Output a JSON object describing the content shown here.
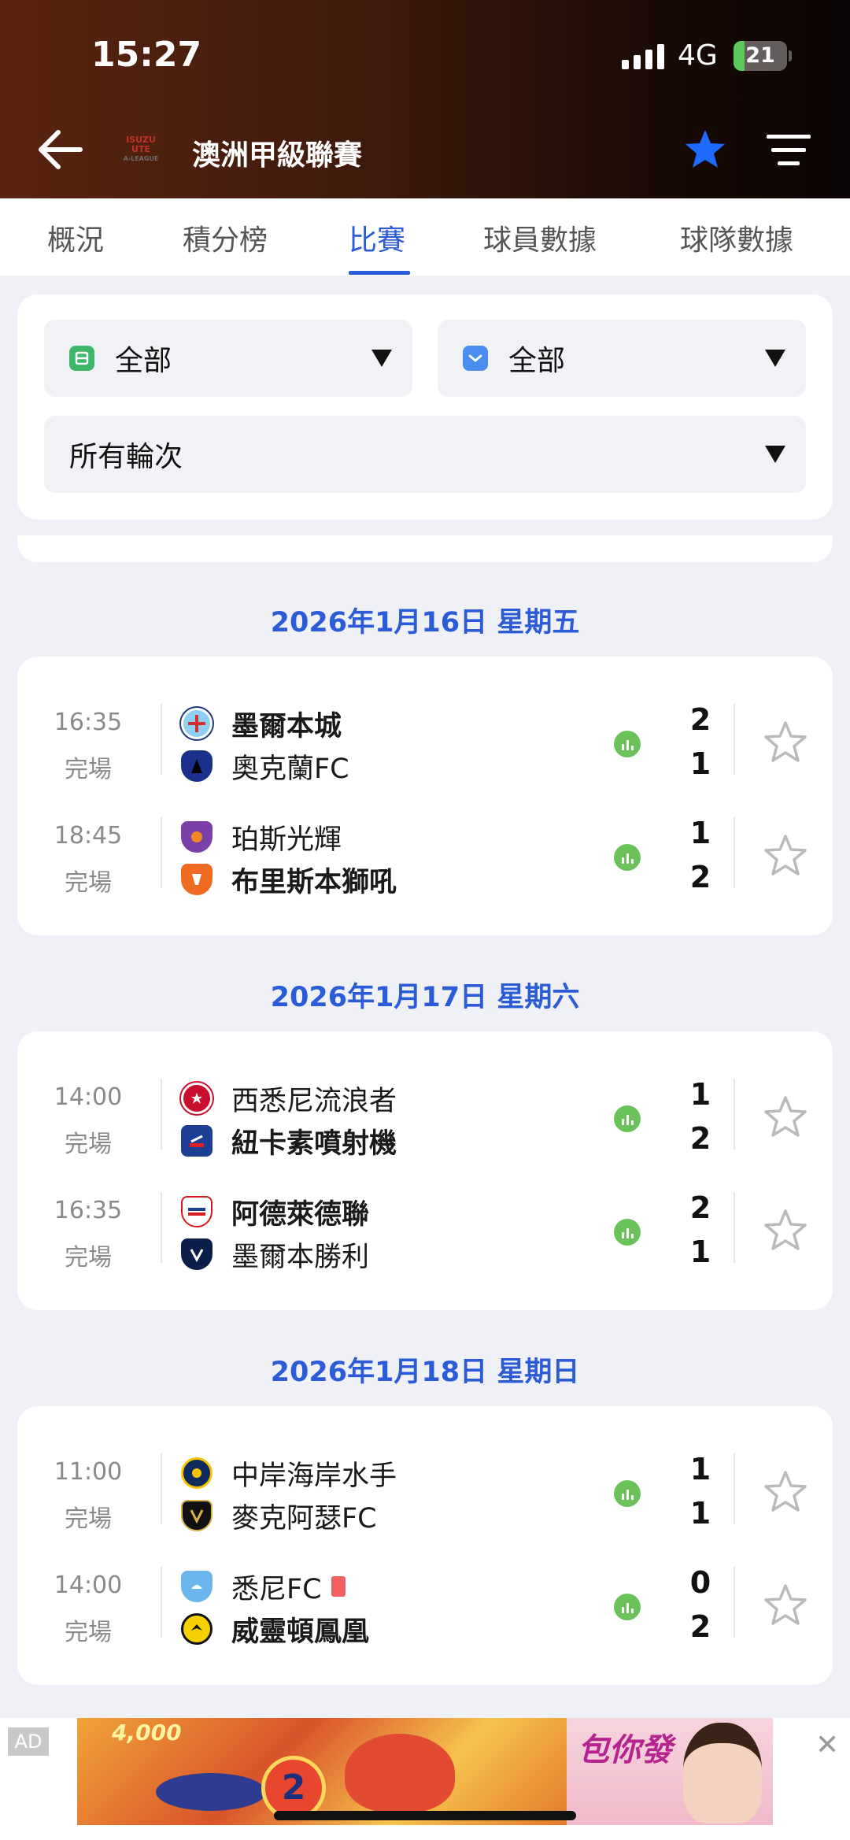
{
  "status_bar": {
    "time": "15:27",
    "network": "4G",
    "battery": "21",
    "battery_level": 0.21
  },
  "header": {
    "title": "澳洲甲級聯賽",
    "logo_text": [
      "ISUZU",
      "UTE",
      "A-LEAGUE"
    ],
    "favorite_color": "#1f6bff"
  },
  "tabs": [
    {
      "label": "概況"
    },
    {
      "label": "積分榜"
    },
    {
      "label": "比賽",
      "active": true
    },
    {
      "label": "球員數據"
    },
    {
      "label": "球隊數據"
    }
  ],
  "filters": {
    "team_filter": "全部",
    "date_filter": "全部",
    "round_filter": "所有輪次"
  },
  "days": [
    {
      "date": "2026年1月16日 星期五",
      "matches": [
        {
          "time": "16:35",
          "status": "完場",
          "home": {
            "name": "墨爾本城",
            "score": "2",
            "win": true,
            "logo": "melbourne-city-icon"
          },
          "away": {
            "name": "奧克蘭FC",
            "score": "1",
            "win": false,
            "logo": "auckland-fc-icon"
          }
        },
        {
          "time": "18:45",
          "status": "完場",
          "home": {
            "name": "珀斯光輝",
            "score": "1",
            "win": false,
            "logo": "perth-glory-icon"
          },
          "away": {
            "name": "布里斯本獅吼",
            "score": "2",
            "win": true,
            "logo": "brisbane-roar-icon"
          }
        }
      ]
    },
    {
      "date": "2026年1月17日 星期六",
      "matches": [
        {
          "time": "14:00",
          "status": "完場",
          "home": {
            "name": "西悉尼流浪者",
            "score": "1",
            "win": false,
            "logo": "western-sydney-icon"
          },
          "away": {
            "name": "紐卡素噴射機",
            "score": "2",
            "win": true,
            "logo": "newcastle-jets-icon"
          }
        },
        {
          "time": "16:35",
          "status": "完場",
          "home": {
            "name": "阿德萊德聯",
            "score": "2",
            "win": true,
            "logo": "adelaide-united-icon"
          },
          "away": {
            "name": "墨爾本勝利",
            "score": "1",
            "win": false,
            "logo": "melbourne-victory-icon"
          }
        }
      ]
    },
    {
      "date": "2026年1月18日 星期日",
      "matches": [
        {
          "time": "11:00",
          "status": "完場",
          "home": {
            "name": "中岸海岸水手",
            "score": "1",
            "win": false,
            "logo": "central-coast-icon"
          },
          "away": {
            "name": "麥克阿瑟FC",
            "score": "1",
            "win": false,
            "logo": "macarthur-fc-icon"
          }
        },
        {
          "time": "14:00",
          "status": "完場",
          "home": {
            "name": "悉尼FC",
            "score": "0",
            "win": false,
            "logo": "sydney-fc-icon",
            "red_card": true
          },
          "away": {
            "name": "威靈頓鳳凰",
            "score": "2",
            "win": true,
            "logo": "wellington-phoenix-icon"
          }
        }
      ]
    }
  ],
  "ad": {
    "label": "AD",
    "amount": "4,000",
    "coin": "2",
    "brand": "包你發"
  },
  "colors": {
    "accent": "#2b5bd6",
    "stats_green": "#6cc25a",
    "red_card": "#f06060"
  }
}
